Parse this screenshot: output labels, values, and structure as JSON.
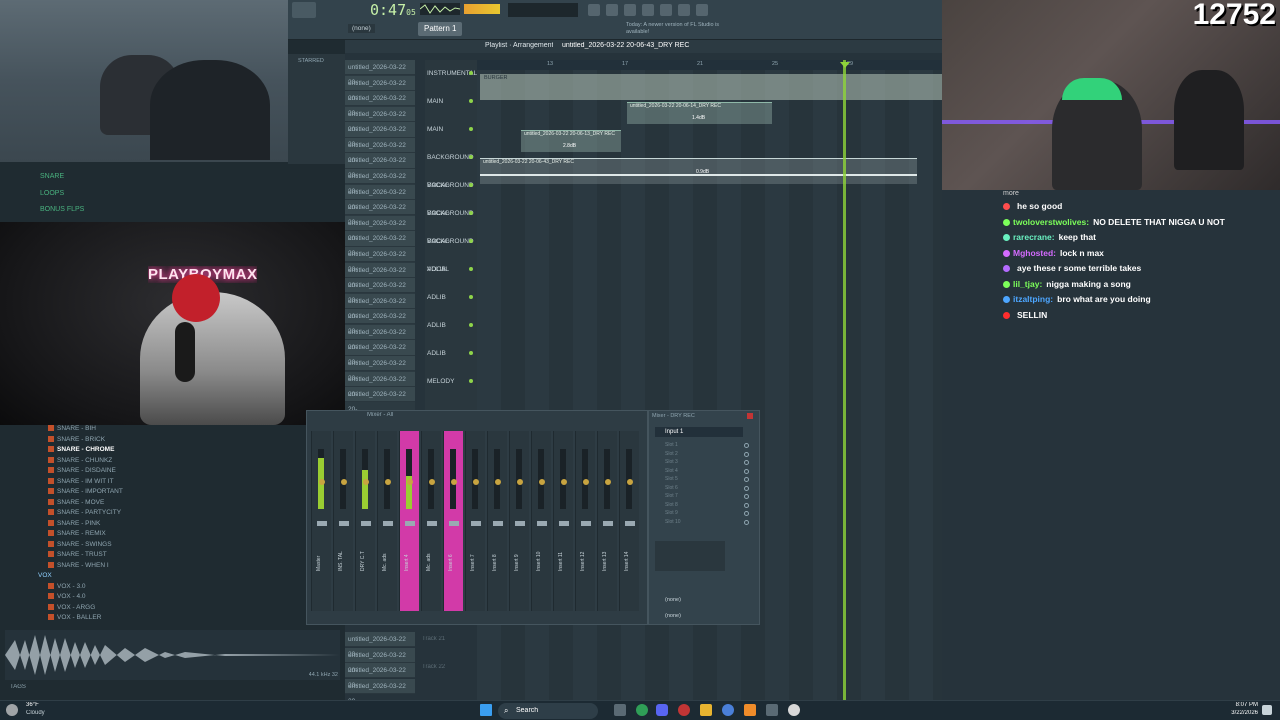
{
  "stream": {
    "viewer_count": "12752",
    "overlay_sign": "PLAYBOYMAX"
  },
  "fl_studio": {
    "time_display": "0:47",
    "time_frames": "05",
    "pattern": "Pattern 1",
    "snap": "(none)",
    "hint_text": "Today: A newer version of FL Studio is available!",
    "playlist_title": "Playlist · Arrangement",
    "playlist_path": "untitled_2026-03-22 20-06-43_DRY REC",
    "browser": {
      "tab_label": "STARRED",
      "folders": [
        "SNARE",
        "LOOPS",
        "BONUS FLPS"
      ],
      "snare_items": [
        "SNARE - BIH",
        "SNARE - BRICK",
        "SNARE - CHROME",
        "SNARE - CHUNKZ",
        "SNARE - DISDAINE",
        "SNARE - IM WIT IT",
        "SNARE - IMPORTANT",
        "SNARE - MOVE",
        "SNARE - PARTYCITY",
        "SNARE - PINK",
        "SNARE - REMIX",
        "SNARE - SWINGS",
        "SNARE - TRUST",
        "SNARE - WHEN I"
      ],
      "vox_folder": "VOX",
      "vox_items": [
        "VOX - 3.0",
        "VOX - 4.0",
        "VOX - ARGG",
        "VOX - BALLER"
      ],
      "waveform_info": "44.1 kHz 32",
      "tags_label": "TAGS"
    },
    "file_list": [
      "untitled_2026-03-22 20-",
      "untitled_2026-03-22 20-",
      "untitled_2026-03-22 20-",
      "untitled_2026-03-22 20-",
      "untitled_2026-03-22 20-",
      "untitled_2026-03-22 20-",
      "untitled_2026-03-22 20-",
      "untitled_2026-03-22 20-",
      "untitled_2026-03-22 20-",
      "untitled_2026-03-22 20-",
      "untitled_2026-03-22 20-",
      "untitled_2026-03-22 20-",
      "untitled_2026-03-22 20-",
      "untitled_2026-03-22 20-",
      "untitled_2026-03-22 20-",
      "untitled_2026-03-22 20-",
      "untitled_2026-03-22 20-",
      "untitled_2026-03-22 20-",
      "untitled_2026-03-22 20-",
      "untitled_2026-03-22 20-",
      "untitled_2026-03-22 20-",
      "untitled_2026-03-22 20-"
    ],
    "tracks": [
      "INSTRUMENTAL",
      "MAIN",
      "MAIN",
      "BACKGROUND VOCAL",
      "BACKGROUND VOCAL",
      "BACKGROUND VOCAL",
      "BACKGROUND VOCAL",
      "ADLIB",
      "ADLIB",
      "ADLIB",
      "ADLIB",
      "MELODY"
    ],
    "clips": {
      "instrumental": "BURGER",
      "main": "untitled_2026-03-22 20-06-14_DRY REC",
      "main_gain": "1.4dB",
      "main2": "untitled_2026-03-22 20-06-13_DRY REC",
      "main2_gain": "2.8dB",
      "bgv": "untitled_2026-03-22 20-06-43_DRY REC",
      "bgv_gain": "0.9dB"
    },
    "ruler_marks": [
      "13",
      "17",
      "21",
      "25",
      "29"
    ],
    "mixer": {
      "title": "Mixer - All",
      "channels": [
        "Master",
        "INS. TAL",
        "DRY C.T",
        "Mc. ads",
        "Insert 4",
        "Mc. ads",
        "Insert 6",
        "Insert 7",
        "Insert 8",
        "Insert 9",
        "Insert 10",
        "Insert 11",
        "Insert 12",
        "Insert 13",
        "Insert 14"
      ],
      "insert_title": "Mixer - DRY REC",
      "input": "Input 1",
      "slots": [
        "Slot 1",
        "Slot 2",
        "Slot 3",
        "Slot 4",
        "Slot 5",
        "Slot 6",
        "Slot 7",
        "Slot 8",
        "Slot 9",
        "Slot 10"
      ],
      "out_none_1": "(none)",
      "out_none_2": "(none)"
    },
    "lower_tracks": [
      "Track 21",
      "Track 22"
    ]
  },
  "chat": {
    "header": "more",
    "messages": [
      {
        "user": "",
        "text": "he so good",
        "color": "#ff4d4d"
      },
      {
        "user": "twoloverstwolives:",
        "text": "NO DELETE THAT NIGGA U NOT",
        "color": "#7cff5a"
      },
      {
        "user": "rarecrane:",
        "text": "keep that",
        "color": "#69f0c0"
      },
      {
        "user": "Mghosted:",
        "text": "lock n max",
        "color": "#d46bff"
      },
      {
        "user": "",
        "text": "aye these r some terrible takes",
        "color": "#b46bff"
      },
      {
        "user": "lil_tjay:",
        "text": "nigga making a song",
        "color": "#7cff5a"
      },
      {
        "user": "itzaltping:",
        "text": "bro what are you doing",
        "color": "#4da6ff"
      },
      {
        "user": "",
        "text": "SELLIN",
        "color": "#ff2d2d"
      }
    ]
  },
  "taskbar": {
    "weather_temp": "36°F",
    "weather_cond": "Cloudy",
    "search": "Search",
    "time": "8:07 PM",
    "date": "3/22/2026"
  },
  "colors": {
    "accent_green": "#8ed44a",
    "playhead": "#8fd43a",
    "pink_channel": "#d23aa8"
  }
}
